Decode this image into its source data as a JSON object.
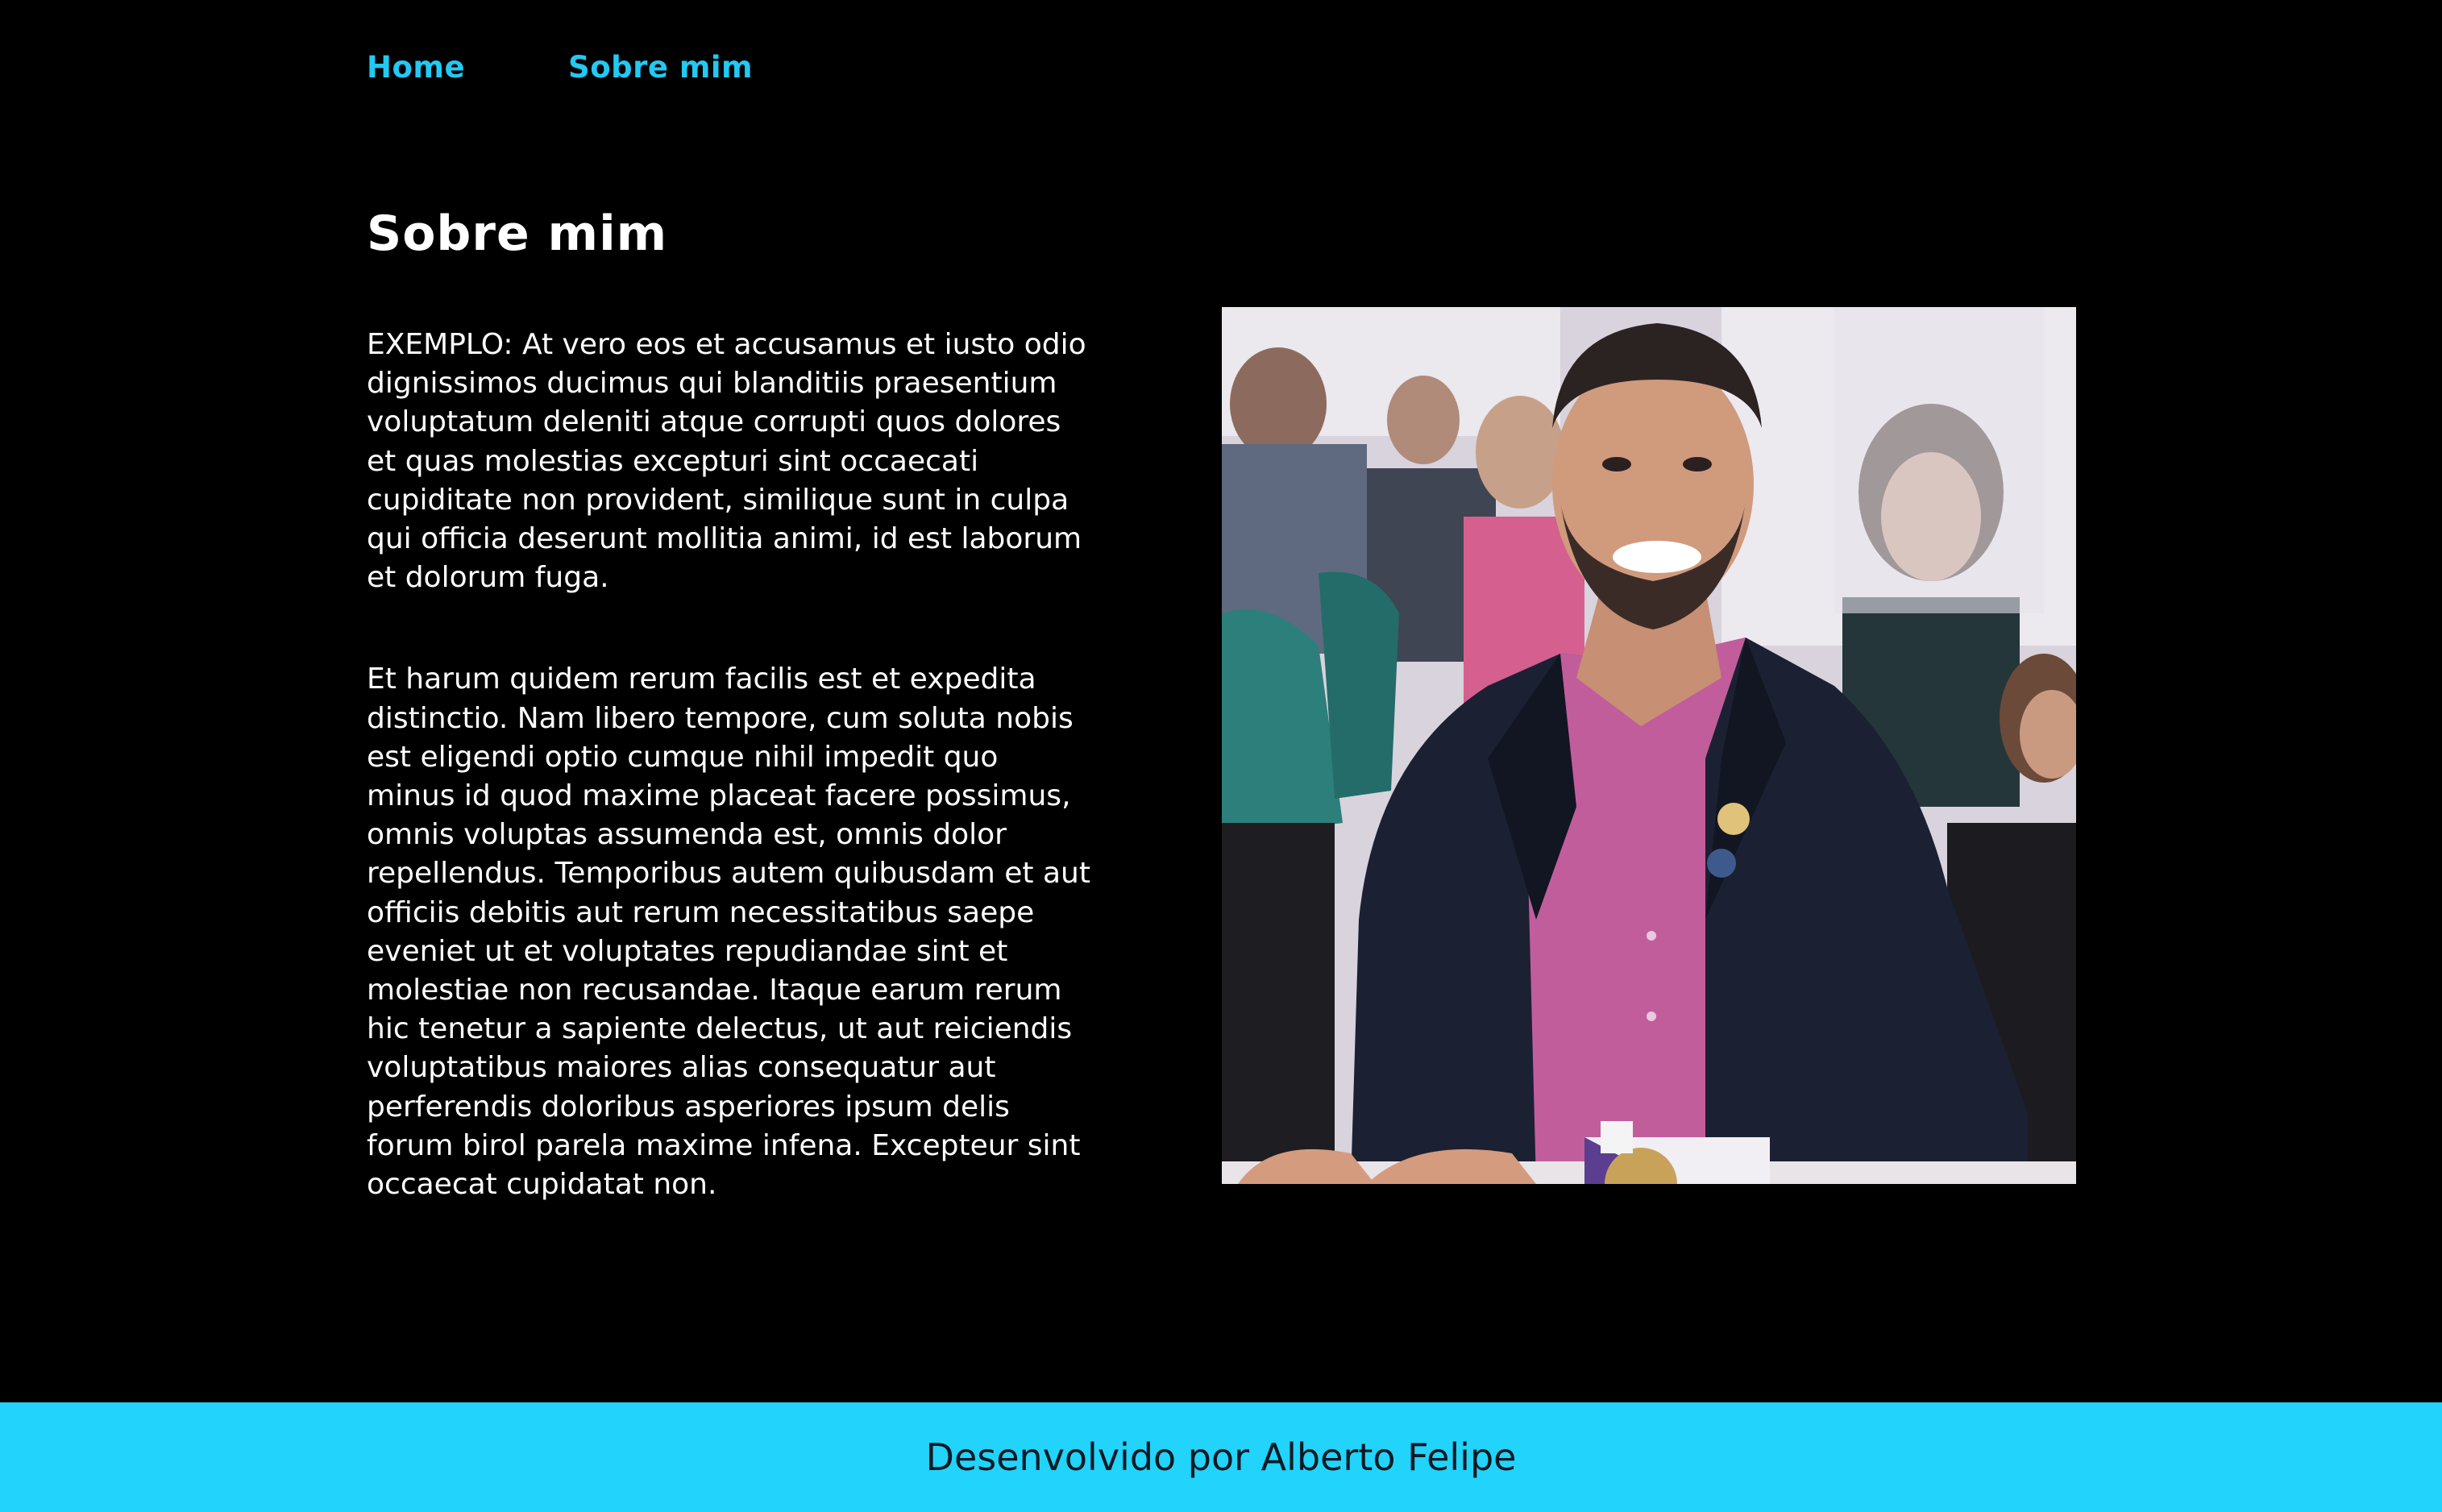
{
  "nav": {
    "items": [
      {
        "label": "Home"
      },
      {
        "label": "Sobre mim"
      }
    ]
  },
  "main": {
    "title": "Sobre mim",
    "paragraphs": [
      "EXEMPLO: At vero eos et accusamus et iusto odio dignissimos ducimus qui blanditiis praesentium voluptatum deleniti atque corrupti quos dolores et quas molestias excepturi sint occaecati cupiditate non provident, similique sunt in culpa qui officia deserunt mollitia animi, id est laborum et dolorum fuga.",
      "Et harum quidem rerum facilis est et expedita distinctio. Nam libero tempore, cum soluta nobis est eligendi optio cumque nihil impedit quo minus id quod maxime placeat facere possimus, omnis voluptas assumenda est, omnis dolor repellendus. Temporibus autem quibusdam et aut officiis debitis aut rerum necessitatibus saepe eveniet ut et voluptates repudiandae sint et molestiae non recusandae. Itaque earum rerum hic tenetur a sapiente delectus, ut aut reiciendis voluptatibus maiores alias consequatur aut perferendis doloribus asperiores ipsum delis forum birol parela maxime infena. Excepteur sint occaecat cupidatat non."
    ]
  },
  "footer": {
    "text": "Desenvolvido por Alberto Felipe"
  },
  "colors": {
    "background": "#000000",
    "accent": "#22c9f2",
    "footer_bg": "#22d3fc",
    "text": "#ffffff"
  }
}
